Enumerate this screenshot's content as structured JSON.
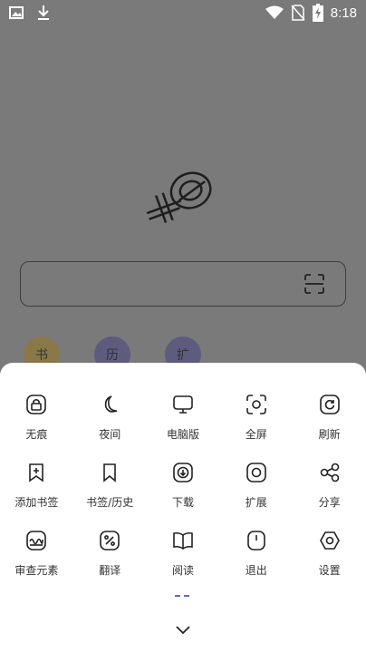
{
  "status_bar": {
    "time": "8:18",
    "icons": [
      "image-icon",
      "download-icon",
      "wifi-icon",
      "no-sim-icon",
      "battery-charging-icon"
    ]
  },
  "home": {
    "logo": "xq-logo",
    "search": {
      "placeholder": "",
      "scan_icon": "scan-icon"
    },
    "shortcuts": [
      {
        "label": "书",
        "color": "#c49a34"
      },
      {
        "label": "历",
        "color": "#6a64b8"
      },
      {
        "label": "扩",
        "color": "#6a64b8"
      }
    ]
  },
  "menu": {
    "rows": [
      [
        {
          "label": "无痕",
          "icon": "lock-icon"
        },
        {
          "label": "夜间",
          "icon": "moon-icon"
        },
        {
          "label": "电脑版",
          "icon": "monitor-icon"
        },
        {
          "label": "全屏",
          "icon": "fullscreen-icon"
        },
        {
          "label": "刷新",
          "icon": "refresh-icon"
        }
      ],
      [
        {
          "label": "添加书签",
          "icon": "add-bookmark-icon"
        },
        {
          "label": "书签/历史",
          "icon": "bookmark-icon"
        },
        {
          "label": "下载",
          "icon": "download-icon"
        },
        {
          "label": "扩展",
          "icon": "extension-icon"
        },
        {
          "label": "分享",
          "icon": "share-icon"
        }
      ],
      [
        {
          "label": "审查元素",
          "icon": "inspect-icon"
        },
        {
          "label": "翻译",
          "icon": "translate-icon"
        },
        {
          "label": "阅读",
          "icon": "book-icon"
        },
        {
          "label": "退出",
          "icon": "power-icon"
        },
        {
          "label": "设置",
          "icon": "settings-icon"
        }
      ]
    ],
    "page_indicator": {
      "pages": 2,
      "current": 1
    },
    "collapse_icon": "chevron-down-icon"
  }
}
